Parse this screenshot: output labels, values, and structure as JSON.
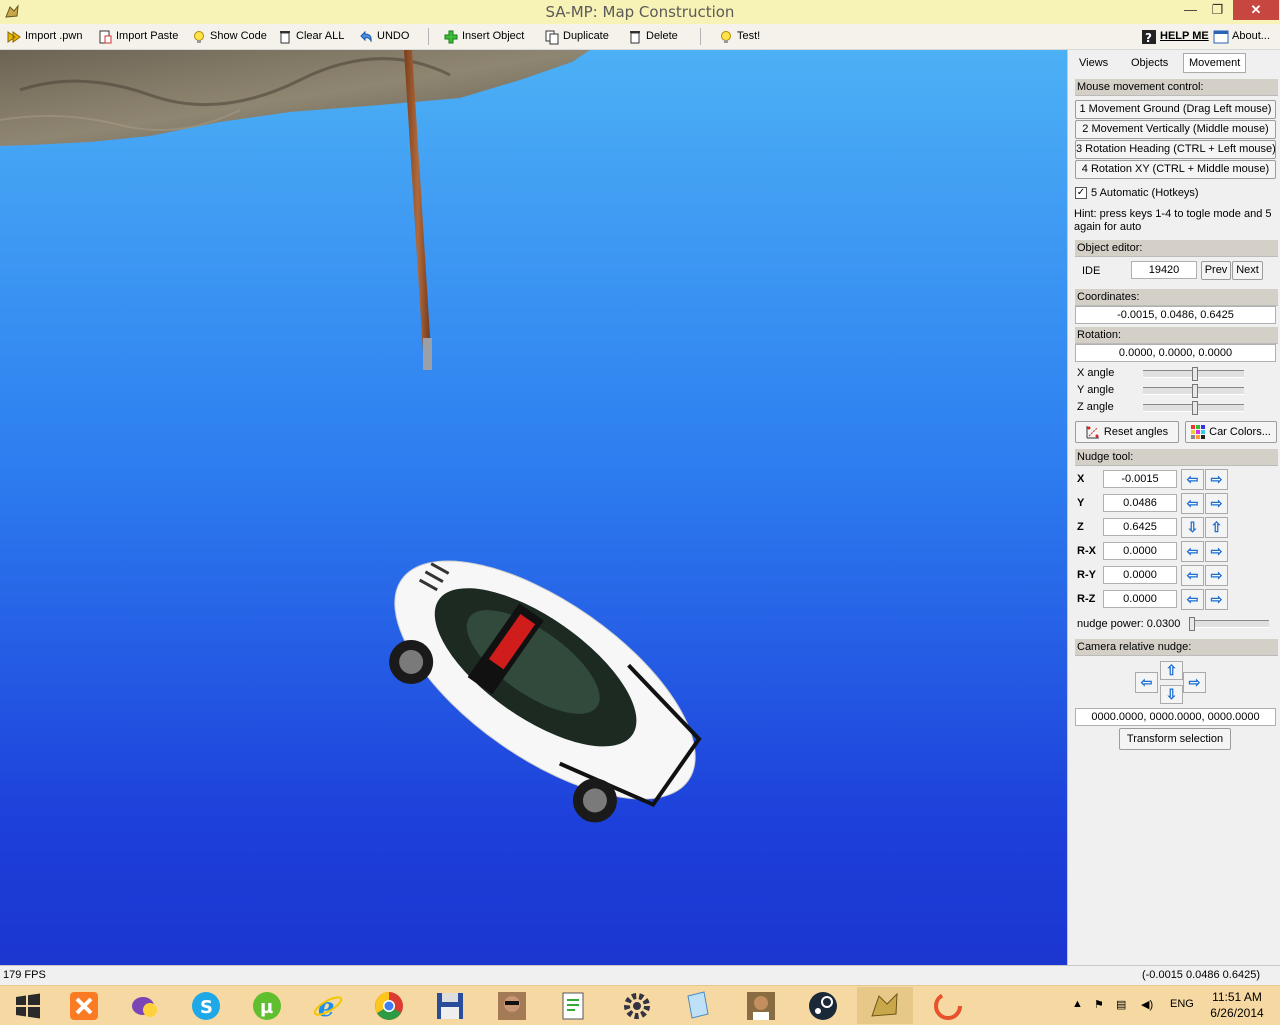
{
  "window": {
    "title": "SA-MP: Map Construction",
    "close": "✕",
    "maximize": "❐",
    "minimize": "—"
  },
  "toolbar": {
    "import_pwn": "Import .pwn",
    "import_paste": "Import Paste",
    "show_code": "Show Code",
    "clear_all": "Clear ALL",
    "undo": "UNDO",
    "insert_object": "Insert Object",
    "duplicate": "Duplicate",
    "delete": "Delete",
    "test": "Test!",
    "help_me": "HELP ME",
    "about": "About..."
  },
  "panel": {
    "tabs": [
      "Views",
      "Objects",
      "Movement"
    ],
    "active_tab": "Movement",
    "mouse_movement_header": "Mouse movement control:",
    "movement_buttons": [
      "1 Movement Ground (Drag Left mouse)",
      "2 Movement Vertically (Middle mouse)",
      "3 Rotation Heading (CTRL + Left mouse)",
      "4 Rotation XY (CTRL + Middle mouse)"
    ],
    "automatic_label": "5 Automatic (Hotkeys)",
    "automatic_checked": true,
    "hint": "Hint: press keys 1-4 to togle mode and 5 again for auto",
    "object_editor_header": "Object editor:",
    "ide_label": "IDE",
    "ide_value": "19420",
    "prev": "Prev",
    "next": "Next",
    "coordinates_header": "Coordinates:",
    "coordinates_value": "-0.0015, 0.0486, 0.6425",
    "rotation_header": "Rotation:",
    "rotation_value": "0.0000, 0.0000, 0.0000",
    "angles": [
      {
        "label": "X angle",
        "level": 0.5
      },
      {
        "label": "Y angle",
        "level": 0.5
      },
      {
        "label": "Z angle",
        "level": 0.5
      }
    ],
    "reset_angles": "Reset angles",
    "car_colors": "Car Colors...",
    "nudge_header": "Nudge tool:",
    "nudge_rows": [
      {
        "label": "X",
        "value": "-0.0015",
        "left": "⇦",
        "right": "⇨"
      },
      {
        "label": "Y",
        "value": "0.0486",
        "left": "⇦",
        "right": "⇨"
      },
      {
        "label": "Z",
        "value": "0.6425",
        "left": "⇩",
        "right": "⇧"
      },
      {
        "label": "R-X",
        "value": "0.0000",
        "left": "⇦",
        "right": "⇨"
      },
      {
        "label": "R-Y",
        "value": "0.0000",
        "left": "⇦",
        "right": "⇨"
      },
      {
        "label": "R-Z",
        "value": "0.0000",
        "left": "⇦",
        "right": "⇨"
      }
    ],
    "nudge_power_label": "nudge power: 0.0300",
    "nudge_power_level": 0.0,
    "camera_nudge_header": "Camera relative nudge:",
    "camera_arrows": {
      "up": "⇧",
      "down": "⇩",
      "left": "⇦",
      "right": "⇨"
    },
    "transform_value": "0000.0000, 0000.0000, 0000.0000",
    "transform_selection": "Transform selection"
  },
  "statusbar": {
    "fps": "179 FPS",
    "coords": "(-0.0015 0.0486 0.6425)"
  },
  "taskbar": {
    "apps": [
      "start-icon",
      "xampp-icon",
      "messenger-icon",
      "skype-icon",
      "utorrent-icon",
      "ie-icon",
      "chrome-icon",
      "save-disk-icon",
      "gta-character-icon",
      "notepad-icon",
      "gear-icon",
      "document-icon",
      "gta-sa-icon",
      "steam-icon",
      "map-construction-icon",
      "record-icon"
    ],
    "lang": "ENG",
    "time": "11:51 AM",
    "date": "6/26/2014"
  }
}
